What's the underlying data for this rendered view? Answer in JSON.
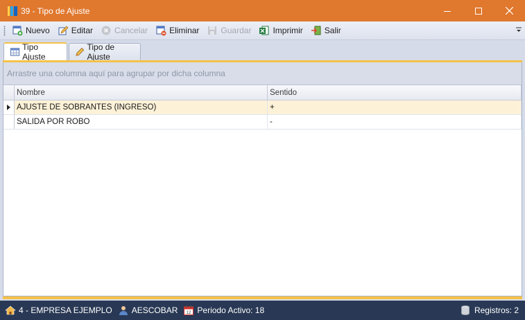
{
  "window": {
    "title": "39 - Tipo de Ajuste"
  },
  "toolbar": {
    "items": [
      {
        "label": "Nuevo",
        "icon": "new-document-icon",
        "enabled": true
      },
      {
        "label": "Editar",
        "icon": "edit-pencil-icon",
        "enabled": true
      },
      {
        "label": "Cancelar",
        "icon": "cancel-icon",
        "enabled": false
      },
      {
        "label": "Eliminar",
        "icon": "delete-document-icon",
        "enabled": true
      },
      {
        "label": "Guardar",
        "icon": "save-disk-icon",
        "enabled": false
      },
      {
        "label": "Imprimir",
        "icon": "excel-print-icon",
        "enabled": true
      },
      {
        "label": "Salir",
        "icon": "exit-icon",
        "enabled": true
      }
    ]
  },
  "tabs": [
    {
      "label": "Tipo Ajuste",
      "icon": "table-icon",
      "active": true
    },
    {
      "label": "Tipo de Ajuste",
      "icon": "edit-pencil-icon",
      "active": false
    }
  ],
  "grid": {
    "group_hint": "Arrastre una columna aquí para agrupar por dicha columna",
    "columns": [
      "Nombre",
      "Sentido"
    ],
    "rows": [
      {
        "nombre": "AJUSTE DE SOBRANTES (INGRESO)",
        "sentido": "+",
        "selected": true
      },
      {
        "nombre": "SALIDA POR ROBO",
        "sentido": "-",
        "selected": false
      }
    ]
  },
  "statusbar": {
    "empresa": "4 - EMPRESA EJEMPLO",
    "usuario": "AESCOBAR",
    "periodo": "Periodo Activo: 18",
    "registros": "Registros: 2"
  },
  "colors": {
    "titlebar": "#e0782e",
    "accent": "#f5c247",
    "statusbar": "#293955",
    "selected_row": "#fdf2d8"
  }
}
